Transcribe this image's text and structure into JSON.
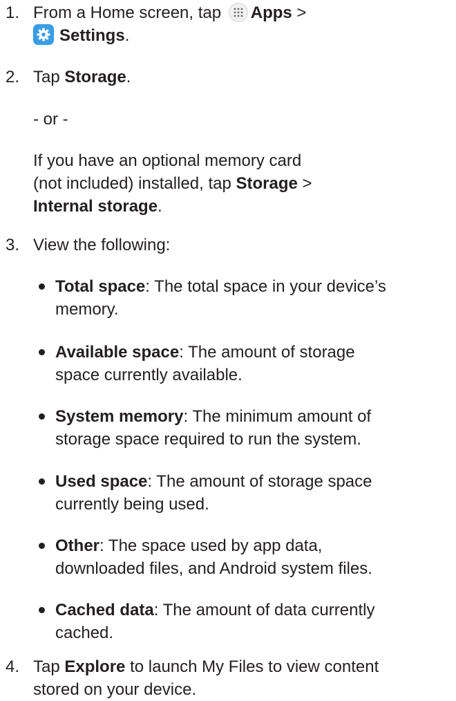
{
  "steps": [
    {
      "number": "1.",
      "text_before": "From a Home screen, tap ",
      "apps_label": "Apps",
      "separator": " >",
      "settings_label": "Settings",
      "period": "."
    },
    {
      "number": "2.",
      "text_before": "Tap ",
      "storage_label": "Storage",
      "period": ".",
      "or_text": "- or -",
      "optional_line1": "If you have an optional memory card",
      "optional_line2_before": "(not included) installed, tap ",
      "optional_storage": "Storage",
      "optional_separator": " >",
      "optional_internal": "Internal storage",
      "optional_period": "."
    },
    {
      "number": "3.",
      "text": "View the following:"
    },
    {
      "number": "4.",
      "text_before": "Tap ",
      "explore_label": "Explore",
      "line1_after": " to launch My Files to view content",
      "line2": "stored on your device."
    }
  ],
  "bullets": [
    {
      "term": "Total space",
      "line1": ": The total space in your device’s",
      "line2": "memory."
    },
    {
      "term": "Available space",
      "line1": ": The amount of storage",
      "line2": "space currently available."
    },
    {
      "term": "System memory",
      "line1": ": The minimum amount of",
      "line2": "storage space required to run the system."
    },
    {
      "term": "Used space",
      "line1": ": The amount of storage space",
      "line2": "currently being used."
    },
    {
      "term": "Other",
      "line1": ": The space used by app data,",
      "line2": "downloaded files, and Android system files."
    },
    {
      "term": "Cached data",
      "line1": ": The amount of data currently",
      "line2": "cached."
    }
  ],
  "icons": {
    "apps": "apps-grid-icon",
    "settings": "settings-gear-icon"
  },
  "colors": {
    "text": "#231f20",
    "settings_icon_bg": "#3a9ce6",
    "apps_icon_bg": "#f1f1f1"
  }
}
